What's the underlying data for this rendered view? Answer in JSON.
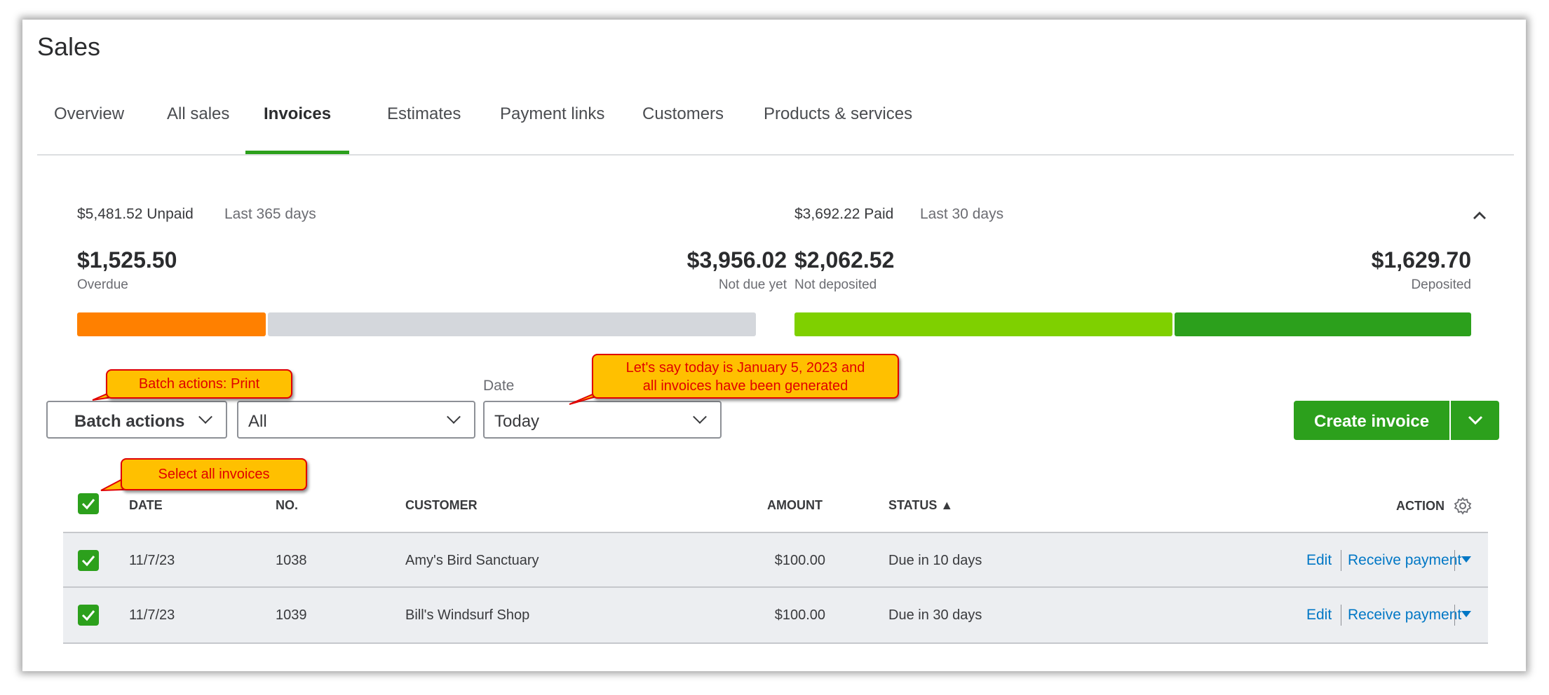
{
  "page": {
    "title": "Sales"
  },
  "tabs": [
    {
      "label": "Overview"
    },
    {
      "label": "All sales"
    },
    {
      "label": "Invoices",
      "active": true
    },
    {
      "label": "Estimates"
    },
    {
      "label": "Payment links"
    },
    {
      "label": "Customers"
    },
    {
      "label": "Products & services"
    }
  ],
  "summary": {
    "unpaid": {
      "total": "$5,481.52 Unpaid",
      "period": "Last 365 days",
      "overdue_amount": "$1,525.50",
      "overdue_label": "Overdue",
      "not_due_amount": "$3,956.02",
      "not_due_label": "Not due yet",
      "overdue_fraction": 0.278,
      "colors": {
        "overdue": "#ff8000",
        "not_due": "#d4d7dc"
      }
    },
    "paid": {
      "total": "$3,692.22 Paid",
      "period": "Last 30 days",
      "not_deposited_amount": "$2,062.52",
      "not_deposited_label": "Not deposited",
      "deposited_amount": "$1,629.70",
      "deposited_label": "Deposited",
      "not_deposited_fraction": 0.559,
      "colors": {
        "not_deposited": "#7fd000",
        "deposited": "#2ca01c"
      }
    }
  },
  "filters": {
    "batch_actions_label": "Batch actions",
    "status_value": "All",
    "date_label": "Date",
    "date_value": "Today"
  },
  "create_invoice": {
    "label": "Create invoice"
  },
  "callouts": {
    "batch": "Batch actions: Print",
    "date_line1": "Let's say today is January 5, 2023 and",
    "date_line2": "all invoices have been generated",
    "select_all": "Select all invoices"
  },
  "table": {
    "headers": {
      "date": "DATE",
      "no": "NO.",
      "customer": "CUSTOMER",
      "amount": "AMOUNT",
      "status": "STATUS ▲",
      "action": "ACTION"
    },
    "rows": [
      {
        "date": "11/7/23",
        "no": "1038",
        "customer": "Amy's Bird Sanctuary",
        "amount": "$100.00",
        "status": "Due in 10 days",
        "edit": "Edit",
        "receive": "Receive payment"
      },
      {
        "date": "11/7/23",
        "no": "1039",
        "customer": "Bill's Windsurf Shop",
        "amount": "$100.00",
        "status": "Due in 30 days",
        "edit": "Edit",
        "receive": "Receive payment"
      }
    ]
  }
}
